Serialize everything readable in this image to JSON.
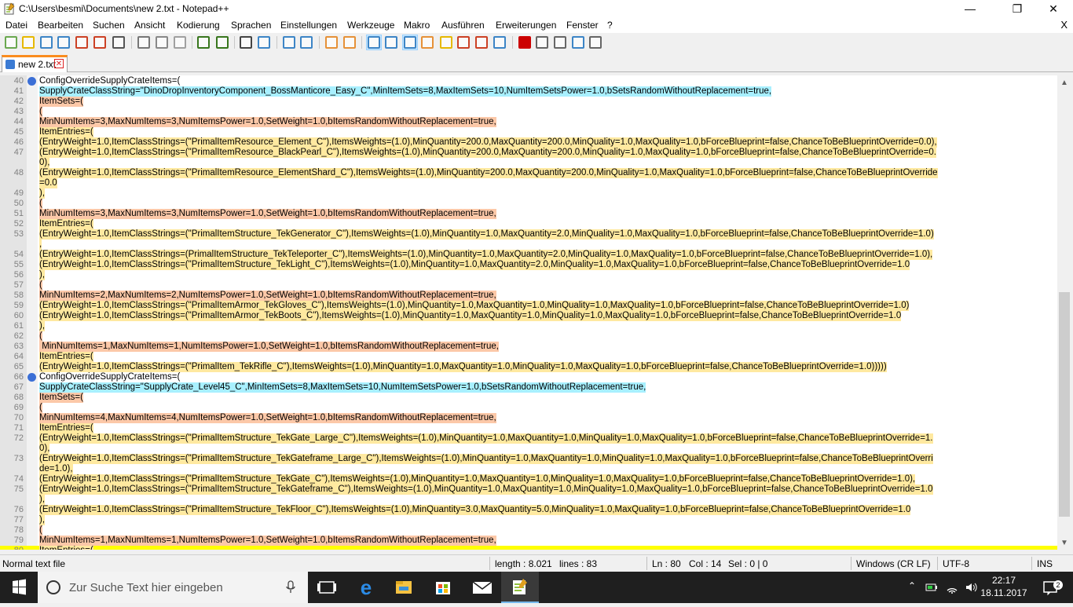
{
  "window": {
    "title": "C:\\Users\\besmi\\Documents\\new 2.txt - Notepad++",
    "minimize": "—",
    "maximize": "❐",
    "close": "✕"
  },
  "menu": {
    "items": [
      "Datei",
      "Bearbeiten",
      "Suchen",
      "Ansicht",
      "Kodierung",
      "Sprachen",
      "Einstellungen",
      "Werkzeuge",
      "Makro",
      "Ausführen",
      "Erweiterungen",
      "Fenster",
      "?"
    ],
    "close_x": "X"
  },
  "toolbar": {
    "icons": [
      "new-file-icon",
      "open-file-icon",
      "save-icon",
      "save-all-icon",
      "close-icon",
      "close-all-icon",
      "print-icon",
      "cut-icon",
      "copy-icon",
      "paste-icon",
      "undo-icon",
      "redo-icon",
      "find-icon",
      "replace-icon",
      "zoom-in-icon",
      "zoom-out-icon",
      "sync-vertical-icon",
      "sync-horizontal-icon",
      "word-wrap-icon",
      "show-all-chars-icon",
      "indent-guide-icon",
      "doc-map-icon",
      "function-list-icon",
      "folder-as-workspace-icon",
      "doc-list-icon",
      "monitoring-icon",
      "record-macro-icon",
      "stop-record-icon",
      "play-macro-icon",
      "run-macro-multiple-icon",
      "save-macro-icon"
    ]
  },
  "tab": {
    "label": "new 2.txt",
    "close": "✕"
  },
  "colors": {
    "hl_orange": "#fcc8a8",
    "hl_yellow": "#ffe9a0",
    "hl_cyan": "#a8f0ff",
    "current_line": "#ffff00",
    "fold_marker": "#3b6fd6"
  },
  "editor": {
    "lines": [
      {
        "n": "40",
        "text": "ConfigOverrideSupplyCrateItems=(",
        "hl": "",
        "fold": true
      },
      {
        "n": "41",
        "text": "SupplyCrateClassString=\"DinoDropInventoryComponent_BossManticore_Easy_C\",MinItemSets=8,MaxItemSets=10,NumItemSetsPower=1.0,bSetsRandomWithoutReplacement=true,",
        "hl": "cyan"
      },
      {
        "n": "42",
        "text": "ItemSets=(",
        "hl": "orange"
      },
      {
        "n": "43",
        "text": "(",
        "hl": "orange"
      },
      {
        "n": "44",
        "text": "MinNumItems=3,MaxNumItems=3,NumItemsPower=1.0,SetWeight=1.0,bItemsRandomWithoutReplacement=true,",
        "hl": "orange"
      },
      {
        "n": "45",
        "text": "ItemEntries=(",
        "hl": "yellow"
      },
      {
        "n": "46",
        "text": "(EntryWeight=1.0,ItemClassStrings=(\"PrimalItemResource_Element_C\"),ItemsWeights=(1.0),MinQuantity=200.0,MaxQuantity=200.0,MinQuality=1.0,MaxQuality=1.0,bForceBlueprint=false,ChanceToBeBlueprintOverride=0.0),",
        "hl": "yellow"
      },
      {
        "n": "47",
        "text": "(EntryWeight=1.0,ItemClassStrings=(\"PrimalItemResource_BlackPearl_C\"),ItemsWeights=(1.0),MinQuantity=200.0,MaxQuantity=200.0,MinQuality=1.0,MaxQuality=1.0,bForceBlueprint=false,ChanceToBeBlueprintOverride=0.",
        "hl": "yellow"
      },
      {
        "n": "",
        "text": "0),",
        "hl": "yellow"
      },
      {
        "n": "48",
        "text": "(EntryWeight=1.0,ItemClassStrings=(\"PrimalItemResource_ElementShard_C\"),ItemsWeights=(1.0),MinQuantity=200.0,MaxQuantity=200.0,MinQuality=1.0,MaxQuality=1.0,bForceBlueprint=false,ChanceToBeBlueprintOverride",
        "hl": "yellow",
        "gapBefore": true
      },
      {
        "n": "",
        "text": "=0.0",
        "hl": "yellow"
      },
      {
        "n": "49",
        "text": "),",
        "hl": "yellow"
      },
      {
        "n": "50",
        "text": "(",
        "hl": "orange"
      },
      {
        "n": "51",
        "text": "MinNumItems=3,MaxNumItems=3,NumItemsPower=1.0,SetWeight=1.0,bItemsRandomWithoutReplacement=true,",
        "hl": "orange"
      },
      {
        "n": "52",
        "text": "ItemEntries=(",
        "hl": "yellow"
      },
      {
        "n": "53",
        "text": "(EntryWeight=1.0,ItemClassStrings=(\"PrimalItemStructure_TekGenerator_C\"),ItemsWeights=(1.0),MinQuantity=1.0,MaxQuantity=2.0,MinQuality=1.0,MaxQuality=1.0,bForceBlueprint=false,ChanceToBeBlueprintOverride=1.0)",
        "hl": "yellow"
      },
      {
        "n": "",
        "text": ",",
        "hl": "yellow"
      },
      {
        "n": "54",
        "text": "(EntryWeight=1.0,ItemClassStrings=(PrimalItemStructure_TekTeleporter_C\"),ItemsWeights=(1.0),MinQuantity=1.0,MaxQuantity=2.0,MinQuality=1.0,MaxQuality=1.0,bForceBlueprint=false,ChanceToBeBlueprintOverride=1.0),",
        "hl": "yellow"
      },
      {
        "n": "55",
        "text": "(EntryWeight=1.0,ItemClassStrings=(\"PrimalItemStructure_TekLight_C\"),ItemsWeights=(1.0),MinQuantity=1.0,MaxQuantity=2.0,MinQuality=1.0,MaxQuality=1.0,bForceBlueprint=false,ChanceToBeBlueprintOverride=1.0",
        "hl": "yellow"
      },
      {
        "n": "56",
        "text": "),",
        "hl": "yellow"
      },
      {
        "n": "57",
        "text": "(",
        "hl": "orange"
      },
      {
        "n": "58",
        "text": "MinNumItems=2,MaxNumItems=2,NumItemsPower=1.0,SetWeight=1.0,bItemsRandomWithoutReplacement=true,",
        "hl": "orange"
      },
      {
        "n": "59",
        "text": "(EntryWeight=1.0,ItemClassStrings=(\"PrimalItemArmor_TekGloves_C\"),ItemsWeights=(1.0),MinQuantity=1.0,MaxQuantity=1.0,MinQuality=1.0,MaxQuality=1.0,bForceBlueprint=false,ChanceToBeBlueprintOverride=1.0)",
        "hl": "yellow"
      },
      {
        "n": "60",
        "text": "(EntryWeight=1.0,ItemClassStrings=(\"PrimalItemArmor_TekBoots_C\"),ItemsWeights=(1.0),MinQuantity=1.0,MaxQuantity=1.0,MinQuality=1.0,MaxQuality=1.0,bForceBlueprint=false,ChanceToBeBlueprintOverride=1.0",
        "hl": "yellow"
      },
      {
        "n": "61",
        "text": "),",
        "hl": "yellow"
      },
      {
        "n": "62",
        "text": "(",
        "hl": "orange"
      },
      {
        "n": "63",
        "text": " MinNumItems=1,MaxNumItems=1,NumItemsPower=1.0,SetWeight=1.0,bItemsRandomWithoutReplacement=true,",
        "hl": "orange"
      },
      {
        "n": "64",
        "text": "ItemEntries=(",
        "hl": "yellow"
      },
      {
        "n": "65",
        "text": "(EntryWeight=1.0,ItemClassStrings=(\"PrimalItem_TekRifle_C\"),ItemsWeights=(1.0),MinQuantity=1.0,MaxQuantity=1.0,MinQuality=1.0,MaxQuality=1.0,bForceBlueprint=false,ChanceToBeBlueprintOverride=1.0)))))",
        "hl": "yellow"
      },
      {
        "n": "66",
        "text": "ConfigOverrideSupplyCrateItems=(",
        "hl": "",
        "fold": true
      },
      {
        "n": "67",
        "text": "SupplyCrateClassString=\"SupplyCrate_Level45_C\",MinItemSets=8,MaxItemSets=10,NumItemSetsPower=1.0,bSetsRandomWithoutReplacement=true,",
        "hl": "cyan"
      },
      {
        "n": "68",
        "text": "ItemSets=(",
        "hl": "orange"
      },
      {
        "n": "69",
        "text": "(",
        "hl": "orange"
      },
      {
        "n": "70",
        "text": "MinNumItems=4,MaxNumItems=4,NumItemsPower=1.0,SetWeight=1.0,bItemsRandomWithoutReplacement=true,",
        "hl": "orange"
      },
      {
        "n": "71",
        "text": "ItemEntries=(",
        "hl": "yellow"
      },
      {
        "n": "72",
        "text": "(EntryWeight=1.0,ItemClassStrings=(\"PrimalItemStructure_TekGate_Large_C\"),ItemsWeights=(1.0),MinQuantity=1.0,MaxQuantity=1.0,MinQuality=1.0,MaxQuality=1.0,bForceBlueprint=false,ChanceToBeBlueprintOverride=1.",
        "hl": "yellow"
      },
      {
        "n": "",
        "text": "0),",
        "hl": "yellow"
      },
      {
        "n": "73",
        "text": "(EntryWeight=1.0,ItemClassStrings=(\"PrimalItemStructure_TekGateframe_Large_C\"),ItemsWeights=(1.0),MinQuantity=1.0,MaxQuantity=1.0,MinQuality=1.0,MaxQuality=1.0,bForceBlueprint=false,ChanceToBeBlueprintOverri",
        "hl": "yellow",
        "gapBefore": true
      },
      {
        "n": "",
        "text": "de=1.0),",
        "hl": "yellow"
      },
      {
        "n": "74",
        "text": "(EntryWeight=1.0,ItemClassStrings=(\"PrimalItemStructure_TekGate_C\"),ItemsWeights=(1.0),MinQuantity=1.0,MaxQuantity=1.0,MinQuality=1.0,MaxQuality=1.0,bForceBlueprint=false,ChanceToBeBlueprintOverride=1.0),",
        "hl": "yellow"
      },
      {
        "n": "75",
        "text": "(EntryWeight=1.0,ItemClassStrings=(\"PrimalItemStructure_TekGateframe_C\"),ItemsWeights=(1.0),MinQuantity=1.0,MaxQuantity=1.0,MinQuality=1.0,MaxQuality=1.0,bForceBlueprint=false,ChanceToBeBlueprintOverride=1.0",
        "hl": "yellow"
      },
      {
        "n": "",
        "text": "),",
        "hl": "yellow"
      },
      {
        "n": "76",
        "text": "(EntryWeight=1.0,ItemClassStrings=(\"PrimalItemStructure_TekFloor_C\"),ItemsWeights=(1.0),MinQuantity=3.0,MaxQuantity=5.0,MinQuality=1.0,MaxQuality=1.0,bForceBlueprint=false,ChanceToBeBlueprintOverride=1.0",
        "hl": "yellow",
        "gapBefore": true
      },
      {
        "n": "77",
        "text": "),",
        "hl": "yellow"
      },
      {
        "n": "78",
        "text": "(",
        "hl": "orange"
      },
      {
        "n": "79",
        "text": "MinNumItems=1,MaxNumItems=1,NumItemsPower=1.0,SetWeight=1.0,bItemsRandomWithoutReplacement=true,",
        "hl": "orange"
      },
      {
        "n": "80",
        "text": "ItemEntries=(",
        "hl": "yellow",
        "current": true
      }
    ]
  },
  "status": {
    "type": "Normal text file",
    "length": "length : 8.021",
    "lines": "lines : 83",
    "ln": "Ln : 80",
    "col": "Col : 14",
    "sel": "Sel : 0 | 0",
    "eol": "Windows (CR LF)",
    "encoding": "UTF-8",
    "mode": "INS"
  },
  "taskbar": {
    "search_placeholder": "Zur Suche Text hier eingeben",
    "apps": [
      "task-view-icon",
      "edge-icon",
      "file-explorer-icon",
      "store-icon",
      "mail-icon",
      "notepad-plus-plus-icon"
    ],
    "time": "22:17",
    "date": "18.11.2017",
    "notifications": "2"
  }
}
